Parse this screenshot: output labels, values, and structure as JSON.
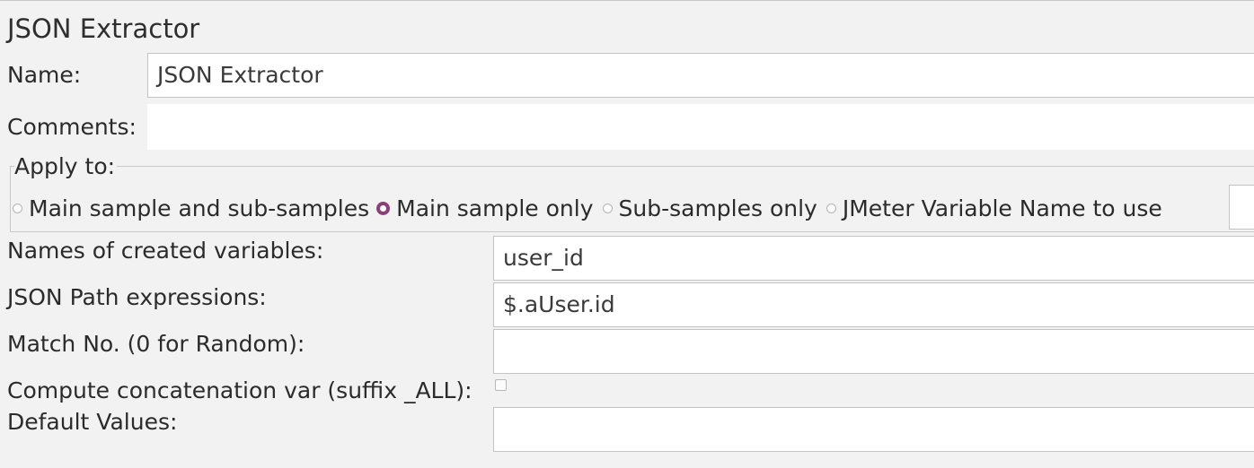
{
  "panel": {
    "title": "JSON Extractor"
  },
  "name": {
    "label": "Name:",
    "value": "JSON Extractor"
  },
  "comments": {
    "label": "Comments:",
    "value": ""
  },
  "apply_to": {
    "legend": "Apply to:",
    "options": [
      {
        "label": "Main sample and sub-samples",
        "selected": false
      },
      {
        "label": "Main sample only",
        "selected": true
      },
      {
        "label": "Sub-samples only",
        "selected": false
      },
      {
        "label": "JMeter Variable Name to use",
        "selected": false
      }
    ],
    "variable_name_value": ""
  },
  "variables": {
    "label": "Names of created variables:",
    "value": "user_id"
  },
  "json_path": {
    "label": "JSON Path expressions:",
    "value": "$.aUser.id"
  },
  "match_no": {
    "label": "Match No. (0 for Random):",
    "value": ""
  },
  "concat": {
    "label": "Compute concatenation var (suffix _ALL):",
    "checked": false
  },
  "default_values": {
    "label": "Default Values:",
    "value": ""
  },
  "colors": {
    "selected_radio": "#8a3f78",
    "background": "#f2f2f2"
  }
}
